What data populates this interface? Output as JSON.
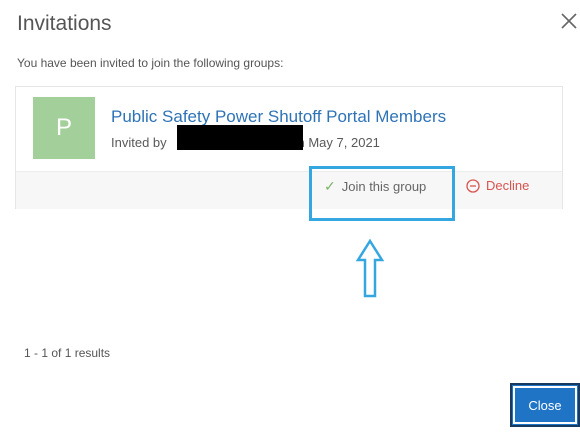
{
  "dialog": {
    "title": "Invitations",
    "intro": "You have been invited to join the following groups:"
  },
  "invitation": {
    "avatar_letter": "P",
    "group_name": "Public Safety Power Shutoff Portal Members",
    "invited_prefix": "Invited by",
    "invited_suffix": "on May 7, 2021",
    "join_label": "Join this group",
    "decline_label": "Decline"
  },
  "footer": {
    "results": "1 - 1 of 1 results",
    "close_label": "Close"
  },
  "colors": {
    "avatar": "#a3cf9a",
    "link": "#2e73b6",
    "decline": "#d9534f",
    "highlight": "#35a7e0",
    "primary_button": "#1f74c6"
  }
}
